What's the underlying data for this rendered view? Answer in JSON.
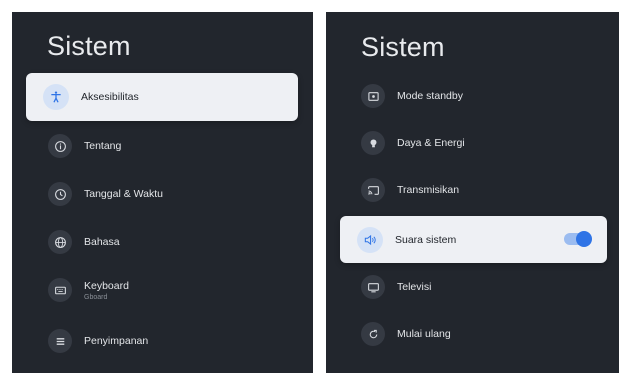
{
  "left": {
    "title": "Sistem",
    "selected": {
      "label": "Aksesibilitas",
      "icon": "accessibility-icon"
    },
    "items": [
      {
        "label": "Tentang",
        "icon": "info-icon"
      },
      {
        "label": "Tanggal & Waktu",
        "icon": "clock-icon"
      },
      {
        "label": "Bahasa",
        "icon": "globe-icon"
      },
      {
        "label": "Keyboard",
        "sublabel": "Gboard",
        "icon": "keyboard-icon"
      },
      {
        "label": "Penyimpanan",
        "icon": "storage-icon"
      }
    ]
  },
  "right": {
    "title": "Sistem",
    "items_top": [
      {
        "label": "Mode standby",
        "icon": "standby-icon"
      },
      {
        "label": "Daya & Energi",
        "icon": "lightbulb-icon"
      },
      {
        "label": "Transmisikan",
        "icon": "cast-icon"
      }
    ],
    "selected": {
      "label": "Suara sistem",
      "icon": "speaker-icon",
      "toggle_on": true
    },
    "items_bottom": [
      {
        "label": "Televisi",
        "icon": "tv-icon"
      },
      {
        "label": "Mulai ulang",
        "icon": "restart-icon"
      }
    ]
  },
  "colors": {
    "panel_bg": "#22262d",
    "selected_bg": "#eef0f4",
    "accent": "#2f74e6",
    "icon_bg": "#353a43"
  }
}
